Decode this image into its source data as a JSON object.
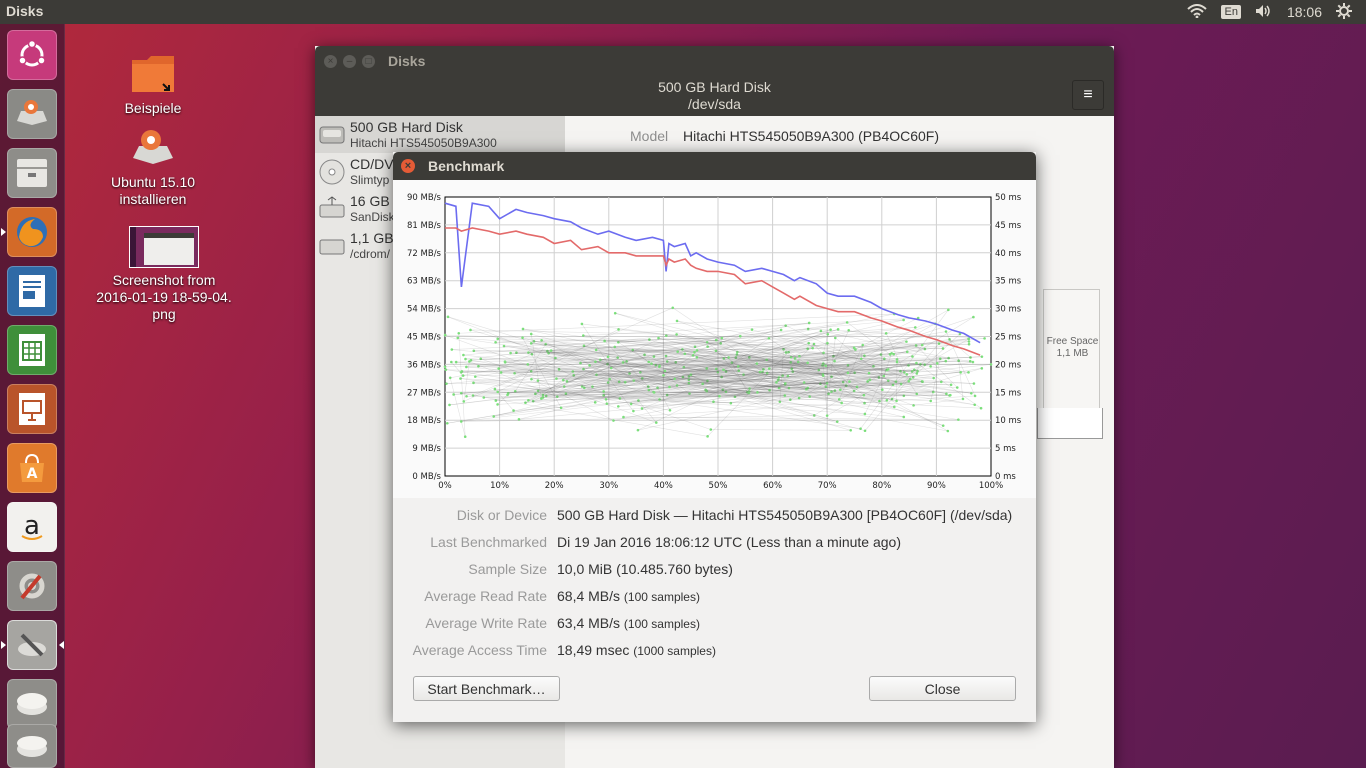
{
  "top_panel": {
    "app_title": "Disks",
    "language": "En",
    "clock": "18:06"
  },
  "launcher": {
    "items": [
      "ubuntu-logo",
      "install-ubuntu",
      "files",
      "firefox",
      "writer",
      "calc",
      "impress",
      "software-center",
      "amazon",
      "system-settings",
      "disks",
      "drive",
      "removable-drive"
    ]
  },
  "desktop": {
    "icons": [
      {
        "label": "Beispiele"
      },
      {
        "label_lines": [
          "Ubuntu 15.10",
          "installieren"
        ]
      },
      {
        "label_lines": [
          "Screenshot from",
          "2016-01-19 18-59-04.",
          "png"
        ]
      }
    ]
  },
  "disks_window": {
    "title": "Disks",
    "header_title": "500 GB Hard Disk",
    "header_subtitle": "/dev/sda",
    "menu_icon": "≡",
    "devices": [
      {
        "name": "500 GB Hard Disk",
        "sub": "Hitachi HTS545050B9A300",
        "icon": "harddisk-icon"
      },
      {
        "name": "CD/DV",
        "sub": "Slimtyp",
        "icon": "optical-disc-icon"
      },
      {
        "name": "16 GB I",
        "sub": "SanDisk",
        "icon": "usb-drive-icon"
      },
      {
        "name": "1,1 GB",
        "sub": "/cdrom/",
        "icon": "disk-image-icon"
      }
    ],
    "model_label": "Model",
    "model_value": "Hitachi HTS545050B9A300 (PB4OC60F)",
    "free_space": [
      "Free Space",
      "1,1 MB"
    ]
  },
  "benchmark": {
    "title": "Benchmark",
    "close_icon": "×",
    "labels": {
      "disk": "Disk or Device",
      "last": "Last Benchmarked",
      "sample": "Sample Size",
      "read": "Average Read Rate",
      "write": "Average Write Rate",
      "access": "Average Access Time"
    },
    "values": {
      "disk": "500 GB Hard Disk — Hitachi HTS545050B9A300 [PB4OC60F] (/dev/sda)",
      "last": "Di 19 Jan 2016 18:06:12 UTC (Less than a minute ago)",
      "sample": "10,0 MiB (10.485.760 bytes)",
      "read": "68,4 MB/s",
      "read_samples": "(100 samples)",
      "write": "63,4 MB/s",
      "write_samples": "(100 samples)",
      "access": "18,49 msec",
      "access_samples": "(1000 samples)"
    },
    "start_button": "Start Benchmark…",
    "close_button": "Close"
  },
  "chart_data": {
    "type": "line",
    "x_ticks": [
      "0%",
      "10%",
      "20%",
      "30%",
      "40%",
      "50%",
      "60%",
      "70%",
      "80%",
      "90%",
      "100%"
    ],
    "y_left_ticks": [
      "0 MB/s",
      "9 MB/s",
      "18 MB/s",
      "27 MB/s",
      "36 MB/s",
      "45 MB/s",
      "54 MB/s",
      "63 MB/s",
      "72 MB/s",
      "81 MB/s",
      "90 MB/s"
    ],
    "y_right_ticks": [
      "0 ms",
      "5 ms",
      "10 ms",
      "15 ms",
      "20 ms",
      "25 ms",
      "30 ms",
      "35 ms",
      "40 ms",
      "45 ms",
      "50 ms"
    ],
    "x_range": [
      0,
      100
    ],
    "y_left_range": [
      0,
      90
    ],
    "y_right_range": [
      0,
      50
    ],
    "grid": true,
    "series": [
      {
        "color": "#6c6cf0",
        "axis": "left",
        "x": [
          0,
          2,
          3,
          5,
          8,
          10,
          13,
          15,
          18,
          20,
          23,
          25,
          28,
          30,
          33,
          35,
          38,
          40,
          40.5,
          41,
          42,
          44,
          45,
          46,
          48,
          50,
          53,
          55,
          58,
          60,
          62,
          64,
          65,
          68,
          70,
          72,
          75,
          78,
          80,
          83,
          85,
          88,
          90,
          93,
          95,
          98
        ],
        "y": [
          88,
          87,
          61,
          88,
          87,
          83,
          86,
          85,
          84,
          83,
          82,
          80,
          78,
          79,
          77,
          76,
          77,
          76,
          66,
          75,
          74,
          75,
          71,
          72,
          70,
          69,
          68,
          66,
          67,
          66,
          65,
          63,
          64,
          62,
          59,
          58,
          58,
          56,
          54,
          52,
          51,
          50,
          49,
          47,
          46,
          43
        ]
      },
      {
        "color": "#e36a6a",
        "axis": "left",
        "x": [
          0,
          2,
          3,
          5,
          8,
          10,
          13,
          15,
          18,
          20,
          23,
          25,
          28,
          30,
          33,
          35,
          38,
          40,
          40.5,
          41,
          42,
          44,
          45,
          46,
          48,
          50,
          53,
          55,
          58,
          60,
          62,
          64,
          65,
          68,
          70,
          72,
          75,
          78,
          80,
          83,
          85,
          88,
          90,
          93,
          95,
          98
        ],
        "y": [
          80,
          80,
          79,
          80,
          79,
          78,
          79,
          78,
          77,
          75,
          76,
          73,
          74,
          72,
          72,
          71,
          71,
          71,
          68,
          70,
          69,
          70,
          68,
          67,
          66,
          66,
          65,
          62,
          63,
          61,
          59,
          57,
          58,
          55,
          54,
          53,
          53,
          51,
          50,
          48,
          47,
          45,
          44,
          42,
          41,
          39
        ]
      },
      {
        "name": "access time samples",
        "color": "#7ee37e",
        "axis": "right",
        "kind": "scatter",
        "count": 1000,
        "mean_ms": 18.49
      }
    ]
  }
}
